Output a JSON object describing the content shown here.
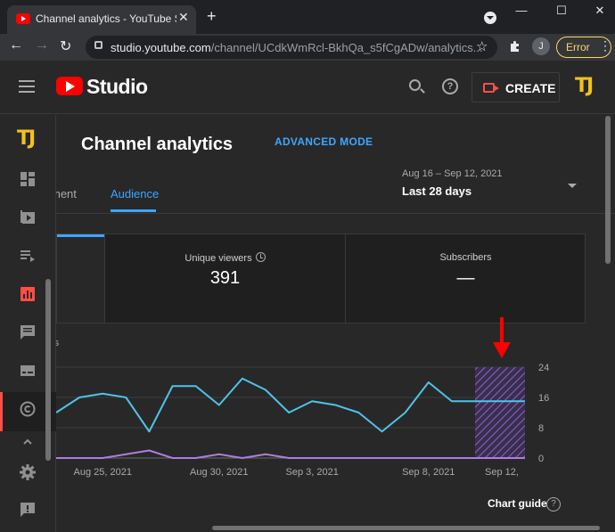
{
  "browser": {
    "tab_title": "Channel analytics - YouTube Stud",
    "tab_close": "✕",
    "new_tab": "+",
    "window_controls": [
      "—",
      "☐",
      "✕"
    ],
    "url_host": "studio.youtube.com",
    "url_path": "/channel/UCdkWmRcl-BkhQa_s5fCgADw/analytics...",
    "profile_initial": "J",
    "error_chip": "Error",
    "nav": {
      "back": "←",
      "forward": "→",
      "reload": "↻"
    },
    "star": "☆",
    "extensions_icon": "puzzle-icon"
  },
  "header": {
    "logo_text": "Studio",
    "create_label": "CREATE",
    "avatar_text": "TJ"
  },
  "sidebar": {
    "avatar_text": "TJ",
    "items": [
      {
        "icon": "dashboard-icon"
      },
      {
        "icon": "content-icon"
      },
      {
        "icon": "playlists-icon"
      },
      {
        "icon": "analytics-icon",
        "active": true
      },
      {
        "icon": "comments-icon"
      },
      {
        "icon": "subtitles-icon"
      },
      {
        "icon": "copyright-icon"
      },
      {
        "icon": "chevron-up-icon"
      },
      {
        "icon": "settings-icon"
      },
      {
        "icon": "feedback-icon"
      }
    ]
  },
  "main": {
    "title": "Channel analytics",
    "advanced_mode": "ADVANCED MODE",
    "date_range": "Aug 16 – Sep 12, 2021",
    "period": "Last 28 days",
    "tabs": [
      {
        "label": "ment",
        "active": false
      },
      {
        "label": "Audience",
        "active": true
      }
    ],
    "cards": [
      {
        "title": "Unique viewers",
        "value": "391"
      },
      {
        "title": "Subscribers",
        "value": "—"
      }
    ],
    "chart_subtitle": "rs",
    "chart_guide": "Chart guide",
    "help_glyph": "?"
  },
  "chart_data": {
    "type": "line",
    "x_tick_labels": [
      "Aug 25, 2021",
      "Aug 30, 2021",
      "Sep 3, 2021",
      "Sep 8, 2021",
      "Sep 12,"
    ],
    "y_tick_labels": [
      "24",
      "16",
      "8",
      "0"
    ],
    "ylim": [
      0,
      24
    ],
    "grid": true,
    "series": [
      {
        "color": "#4fc3e8",
        "values": [
          12,
          16,
          17,
          16,
          7,
          19,
          19,
          14,
          21,
          18,
          12,
          15,
          14,
          12,
          7,
          12,
          20,
          15,
          15
        ]
      },
      {
        "color": "#b07ce0",
        "values": [
          0,
          0,
          0,
          1,
          2,
          0,
          0,
          1,
          0,
          1,
          0,
          0,
          0,
          0,
          0,
          0,
          0,
          0,
          0
        ]
      }
    ],
    "hatched_last_day": true,
    "accent_color": "#ff0000"
  }
}
